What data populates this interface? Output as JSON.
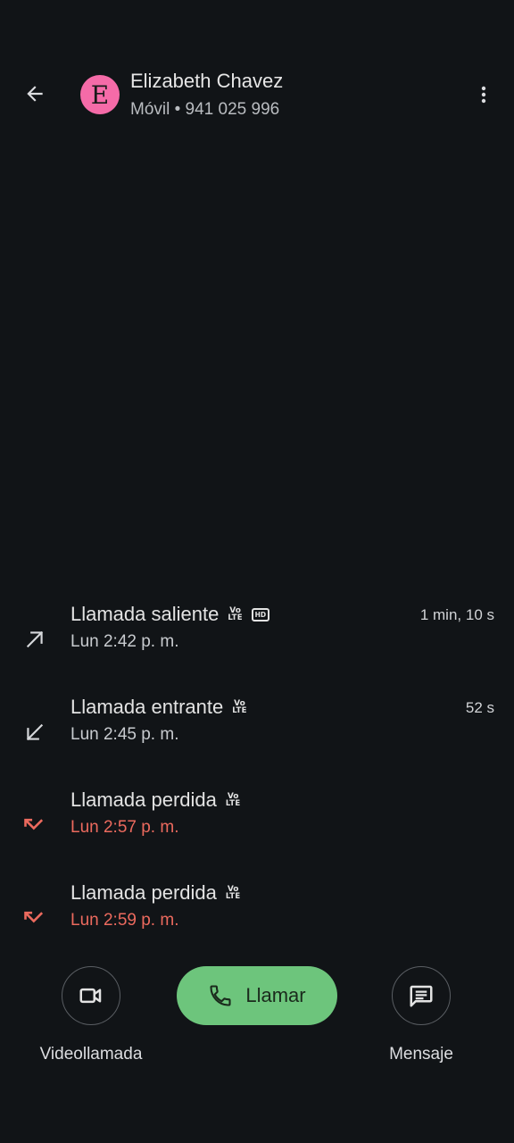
{
  "header": {
    "back_icon": "arrow-back-icon",
    "avatar_letter": "E",
    "avatar_color": "#f56ba8",
    "contact_name": "Elizabeth Chavez",
    "contact_subtitle": "Móvil • 941 025 996",
    "more_icon": "more-vert-icon"
  },
  "calls": [
    {
      "type": "Llamada saliente",
      "time": "Lun 2:42 p. m.",
      "duration": "1 min, 10 s",
      "direction": "outgoing",
      "volte": "Vo LTE",
      "hd": "HD"
    },
    {
      "type": "Llamada entrante",
      "time": "Lun 2:45 p. m.",
      "duration": "52 s",
      "direction": "incoming",
      "volte": "Vo LTE"
    },
    {
      "type": "Llamada perdida",
      "time": "Lun 2:57 p. m.",
      "direction": "missed",
      "volte": "Vo LTE"
    },
    {
      "type": "Llamada perdida",
      "time": "Lun 2:59 p. m.",
      "direction": "missed",
      "volte": "Vo LTE"
    }
  ],
  "actions": {
    "video_label": "Videollamada",
    "video_icon": "videocam-icon",
    "call_label": "Llamar",
    "call_icon": "phone-icon",
    "call_button_color": "#6dc57c",
    "message_label": "Mensaje",
    "message_icon": "message-icon"
  },
  "colors": {
    "background": "#111417",
    "missed": "#ec6a5e"
  }
}
